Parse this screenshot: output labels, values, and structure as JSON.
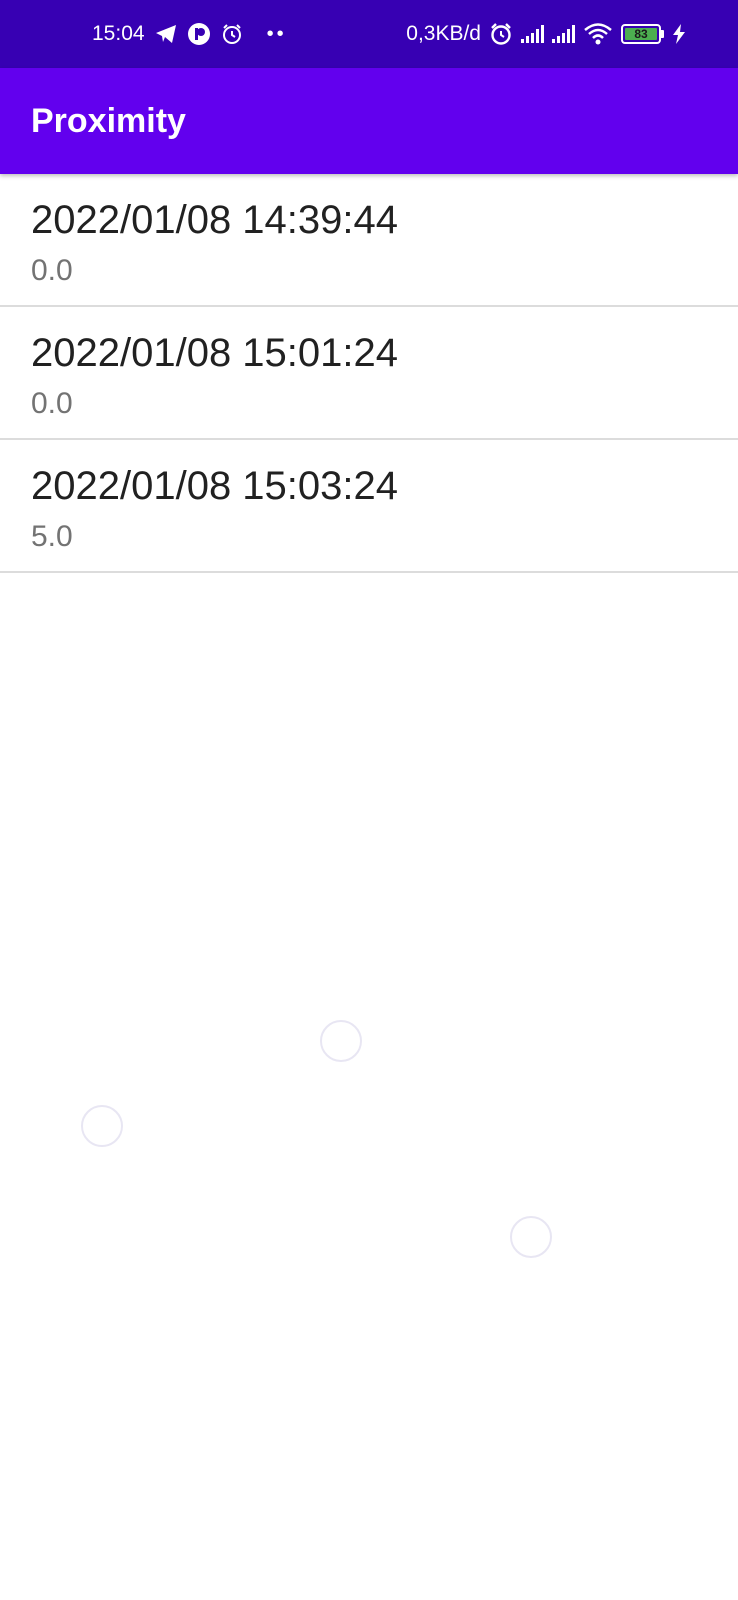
{
  "status_bar": {
    "time": "15:04",
    "left_icons": [
      "telegram-icon",
      "app-notification-icon",
      "alarm-icon"
    ],
    "overflow_dots": "••",
    "network_speed": "0,3KB/d",
    "right_icons": [
      "alarm-icon",
      "signal-icon",
      "signal-icon",
      "wifi-icon",
      "battery-icon",
      "charging-icon"
    ],
    "battery_level": "83",
    "colors": {
      "background": "#3700b3",
      "battery_fill": "#4caf50"
    }
  },
  "app_bar": {
    "title": "Proximity",
    "color": "#6200ee"
  },
  "readings": [
    {
      "timestamp": "2022/01/08 14:39:44",
      "value": "0.0"
    },
    {
      "timestamp": "2022/01/08 15:01:24",
      "value": "0.0"
    },
    {
      "timestamp": "2022/01/08 15:03:24",
      "value": "5.0"
    }
  ]
}
